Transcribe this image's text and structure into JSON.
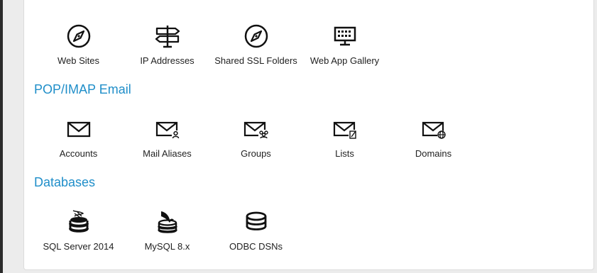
{
  "partial_top_text": "…",
  "websites": {
    "items": [
      {
        "label": "Web Sites",
        "icon": "compass-icon"
      },
      {
        "label": "IP Addresses",
        "icon": "signpost-icon"
      },
      {
        "label": "Shared SSL Folders",
        "icon": "compass-icon"
      },
      {
        "label": "Web App Gallery",
        "icon": "monitor-grid-icon"
      }
    ]
  },
  "email": {
    "title": "POP/IMAP Email",
    "items": [
      {
        "label": "Accounts",
        "icon": "envelope-icon"
      },
      {
        "label": "Mail Aliases",
        "icon": "envelope-user-icon"
      },
      {
        "label": "Groups",
        "icon": "envelope-group-icon"
      },
      {
        "label": "Lists",
        "icon": "envelope-list-icon"
      },
      {
        "label": "Domains",
        "icon": "envelope-globe-icon"
      }
    ]
  },
  "databases": {
    "title": "Databases",
    "items": [
      {
        "label": "SQL Server 2014",
        "icon": "sql-server-icon"
      },
      {
        "label": "MySQL 8.x",
        "icon": "mysql-dolphin-icon"
      },
      {
        "label": "ODBC DSNs",
        "icon": "database-stack-icon"
      }
    ]
  },
  "colors": {
    "section_title": "#1f8ec9",
    "panel_bg": "#ffffff",
    "page_bg": "#ececec",
    "icon": "#111111"
  }
}
